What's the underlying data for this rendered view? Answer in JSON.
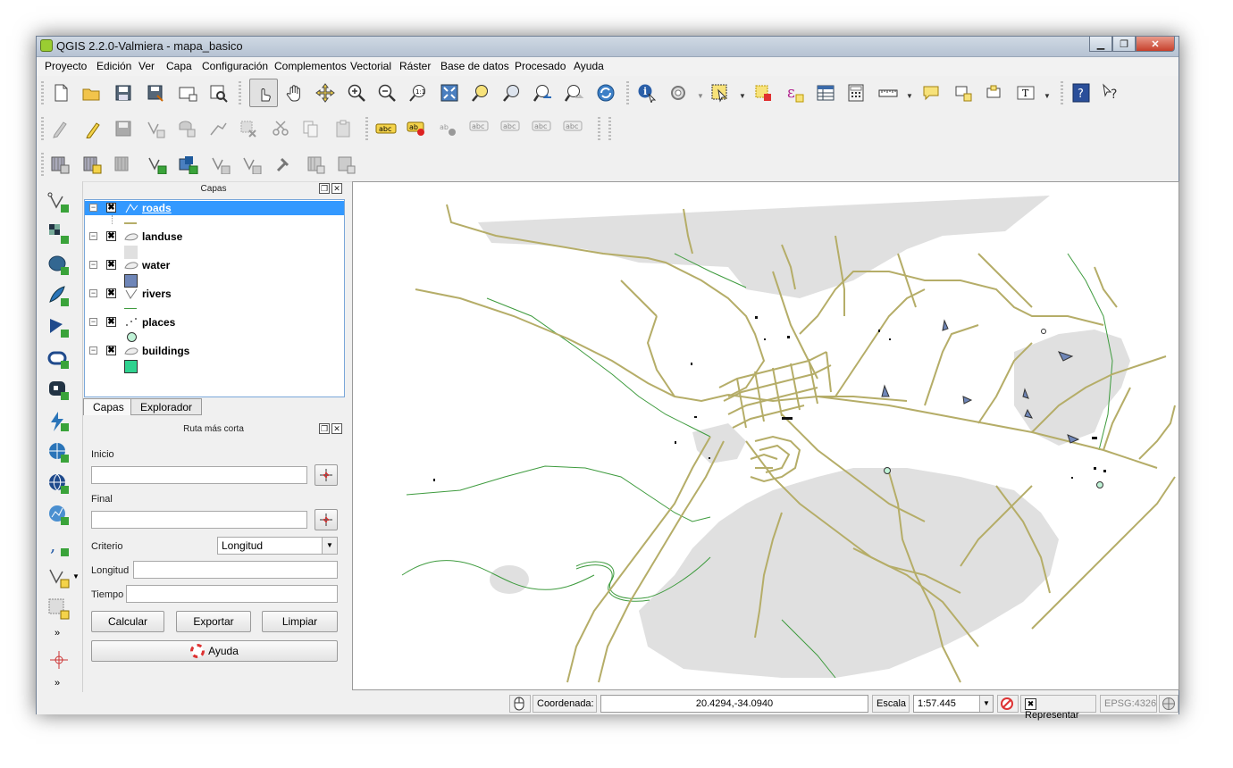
{
  "window": {
    "title": "QGIS 2.2.0-Valmiera - mapa_basico",
    "minimize": "▁",
    "restore": "❐",
    "close": "✕"
  },
  "menu": [
    "Proyecto",
    "Edición",
    "Ver",
    "Capa",
    "Configuración",
    "Complementos",
    "Vectorial",
    "Ráster",
    "Base de datos",
    "Procesado",
    "Ayuda"
  ],
  "layers_panel": {
    "title": "Capas",
    "layers": [
      {
        "name": "roads",
        "checked": "✖",
        "toggle": "−",
        "selected": true
      },
      {
        "name": "landuse",
        "checked": "✖",
        "toggle": "−"
      },
      {
        "name": "water",
        "checked": "✖",
        "toggle": "−"
      },
      {
        "name": "rivers",
        "checked": "✖",
        "toggle": "−"
      },
      {
        "name": "places",
        "checked": "✖",
        "toggle": "−"
      },
      {
        "name": "buildings",
        "checked": "✖",
        "toggle": "−"
      }
    ],
    "tabs": [
      "Capas",
      "Explorador"
    ]
  },
  "route_panel": {
    "title": "Ruta más corta",
    "start_label": "Inicio",
    "end_label": "Final",
    "criteria_label": "Criterio",
    "criteria_value": "Longitud",
    "length_label": "Longitud",
    "time_label": "Tiempo",
    "calc": "Calcular",
    "export": "Exportar",
    "clear": "Limpiar",
    "help": "Ayuda"
  },
  "status": {
    "coord_label": "Coordenada:",
    "coord_value": "20.4294,-34.0940",
    "scale_label": "Escala",
    "scale_value": "1:57.445",
    "render_label": "Representar",
    "render_check": "✖",
    "crs": "EPSG:4326"
  },
  "colors": {
    "road": "#b5ad68",
    "landuse": "#e0e0e0",
    "water": "#6f86b8",
    "river": "#3e9b3e",
    "building": "#2fd28f",
    "selection": "#3399ff"
  }
}
